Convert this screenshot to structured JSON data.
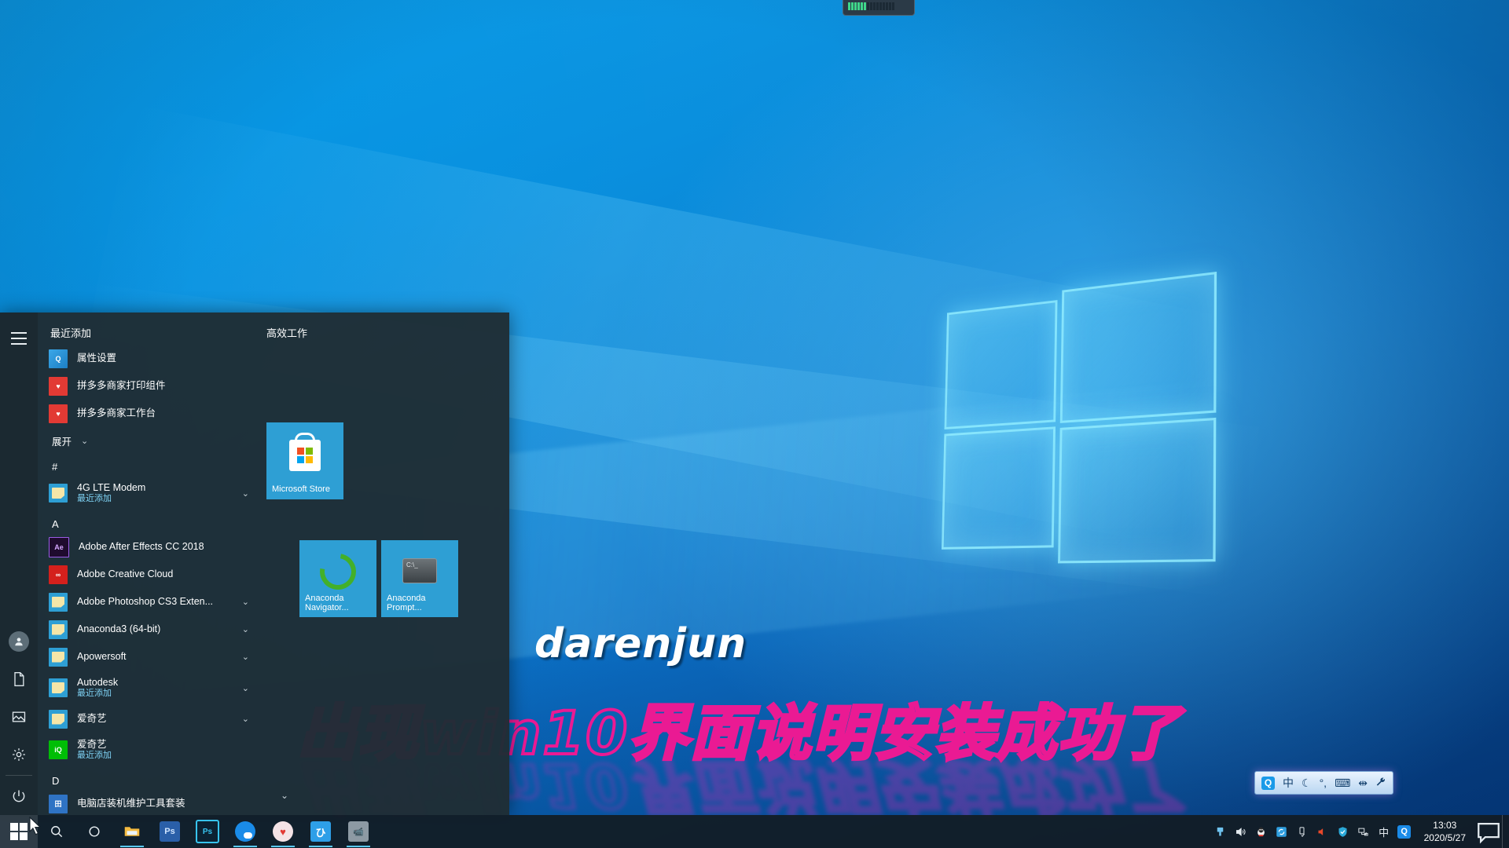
{
  "desktop": {
    "watermark_name": "darenjun",
    "watermark_message": "出现win10界面说明安装成功了",
    "watermark_reflection": "出现win10界面说明安装成功了"
  },
  "start_menu": {
    "rail": {
      "hamburger_label": "展开菜单",
      "items": [
        {
          "name": "user-account",
          "icon": "user-icon"
        },
        {
          "name": "documents",
          "icon": "document-icon"
        },
        {
          "name": "pictures",
          "icon": "picture-icon"
        },
        {
          "name": "settings",
          "icon": "gear-icon"
        },
        {
          "name": "power",
          "icon": "power-icon"
        }
      ]
    },
    "recently_added": {
      "header": "最近添加",
      "items": [
        {
          "label": "属性设置",
          "icon": "qq-app-icon"
        },
        {
          "label": "拼多多商家打印组件",
          "icon": "pinduoduo-icon"
        },
        {
          "label": "拼多多商家工作台",
          "icon": "pinduoduo-icon"
        }
      ],
      "expand_label": "展开"
    },
    "app_groups": [
      {
        "letter": "#",
        "apps": [
          {
            "label": "4G LTE Modem",
            "sub": "最近添加",
            "icon": "folder-icon",
            "chevron": true
          }
        ]
      },
      {
        "letter": "A",
        "apps": [
          {
            "label": "Adobe After Effects CC 2018",
            "sub": "",
            "icon": "after-effects-icon",
            "chevron": false
          },
          {
            "label": "Adobe Creative Cloud",
            "sub": "",
            "icon": "creative-cloud-icon",
            "chevron": false
          },
          {
            "label": "Adobe Photoshop CS3 Exten...",
            "sub": "",
            "icon": "folder-icon",
            "chevron": true
          },
          {
            "label": "Anaconda3 (64-bit)",
            "sub": "",
            "icon": "folder-icon",
            "chevron": true
          },
          {
            "label": "Apowersoft",
            "sub": "",
            "icon": "folder-icon",
            "chevron": true
          },
          {
            "label": "Autodesk",
            "sub": "最近添加",
            "icon": "folder-icon",
            "chevron": true
          },
          {
            "label": "爱奇艺",
            "sub": "",
            "icon": "folder-icon",
            "chevron": true
          },
          {
            "label": "爱奇艺",
            "sub": "最近添加",
            "icon": "iqiyi-icon",
            "chevron": false
          }
        ]
      },
      {
        "letter": "D",
        "apps": [
          {
            "label": "电脑店装机维护工具套装",
            "sub": "",
            "icon": "toolkit-icon",
            "chevron": false
          }
        ]
      }
    ],
    "tile_group": {
      "title": "高效工作",
      "tiles": [
        {
          "label": "Microsoft Store",
          "icon": "microsoft-store-icon",
          "size": "medium"
        },
        {
          "label": "Anaconda Navigator...",
          "icon": "anaconda-navigator-icon",
          "size": "medium"
        },
        {
          "label": "Anaconda Prompt...",
          "icon": "anaconda-prompt-icon",
          "size": "medium"
        }
      ]
    }
  },
  "taskbar": {
    "start_button": "开始",
    "pinned": [
      {
        "name": "search-icon",
        "label": "搜索",
        "type": "icon"
      },
      {
        "name": "cortana-icon",
        "label": "Cortana",
        "type": "icon"
      },
      {
        "name": "file-explorer-icon",
        "label": "文件资源管理器",
        "type": "app",
        "running": true
      },
      {
        "name": "photoshop-icon",
        "label": "Ps",
        "type": "app",
        "running": false
      },
      {
        "name": "photoshop-cs-icon",
        "label": "Ps",
        "type": "app",
        "running": false
      },
      {
        "name": "quark-browser-icon",
        "label": "浏览器",
        "type": "app",
        "running": true
      },
      {
        "name": "pinduoduo-icon",
        "label": "拼多多",
        "type": "app",
        "running": true
      },
      {
        "name": "thunder-icon",
        "label": "迅雷",
        "type": "app",
        "running": true
      },
      {
        "name": "video-tool-icon",
        "label": "录屏工具",
        "type": "app",
        "running": true
      }
    ],
    "tray": [
      {
        "name": "usb-device-icon",
        "label": "USB 设备"
      },
      {
        "name": "volume-icon",
        "label": "音量"
      },
      {
        "name": "qq-icon",
        "label": "QQ"
      },
      {
        "name": "sync-icon",
        "label": "同步"
      },
      {
        "name": "safely-remove-icon",
        "label": "安全删除硬件"
      },
      {
        "name": "speaker-icon",
        "label": "扬声器"
      },
      {
        "name": "security-shield-icon",
        "label": "电脑管家"
      },
      {
        "name": "network-icon",
        "label": "网络"
      },
      {
        "name": "ime-icon",
        "label": "中"
      },
      {
        "name": "qq-browser-icon",
        "label": "QQ浏览器"
      }
    ],
    "clock": {
      "time": "13:03",
      "date": "2020/5/27"
    },
    "notification_label": "通知中心"
  },
  "ime_bar": {
    "items": [
      {
        "name": "qq-ime-logo",
        "glyph": "Q"
      },
      {
        "name": "language-mode",
        "glyph": "中"
      },
      {
        "name": "moon-icon",
        "glyph": "☾"
      },
      {
        "name": "punctuation-icon",
        "glyph": "°,"
      },
      {
        "name": "keyboard-icon",
        "glyph": "⌨"
      },
      {
        "name": "toolbox-icon",
        "glyph": "⇹"
      },
      {
        "name": "settings-wrench-icon",
        "glyph": "🔧"
      }
    ]
  }
}
